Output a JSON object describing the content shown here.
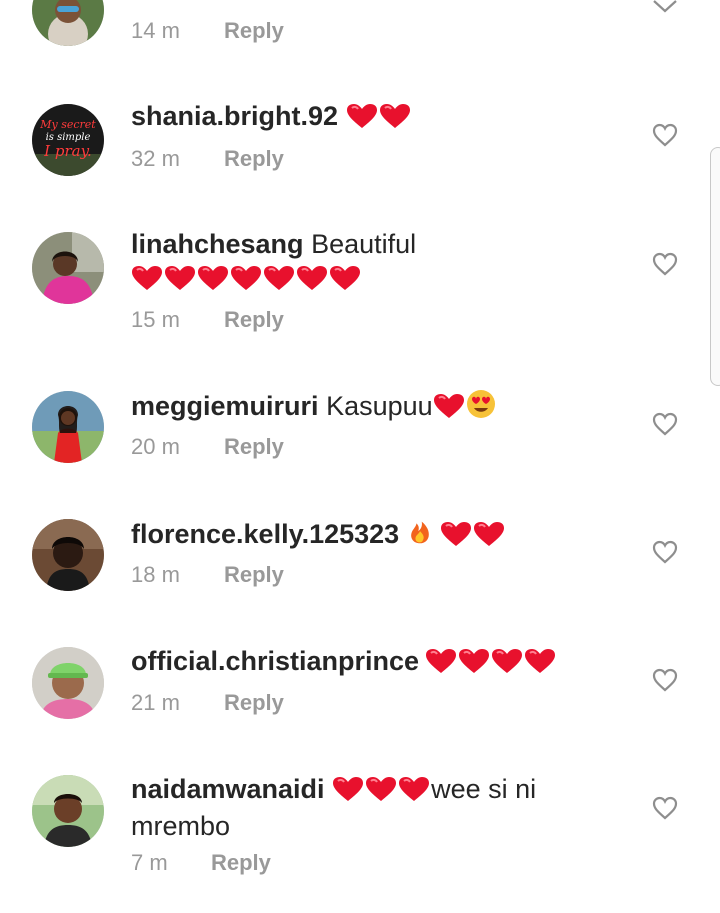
{
  "top_comment": {
    "time": "14 m",
    "reply": "Reply"
  },
  "comments": [
    {
      "username": "shania.bright.92",
      "text": "",
      "hearts": 2,
      "time": "32 m",
      "reply": "Reply",
      "avatar": "avatar-quote-my-secret-is-simple-i-pray",
      "avatar_text": [
        "My secret",
        "is simple",
        "I pray."
      ]
    },
    {
      "username": "linahchesang",
      "text": "Beautiful",
      "hearts": 7,
      "time": "15 m",
      "reply": "Reply",
      "avatar": "avatar-woman-pink"
    },
    {
      "username": "meggiemuiruri",
      "text": "Kasupuu",
      "hearts": 1,
      "time": "20 m",
      "reply": "Reply",
      "avatar": "avatar-woman-red-dress"
    },
    {
      "username": "florence.kelly.125323",
      "text": "",
      "hearts": 2,
      "time": "18 m",
      "reply": "Reply",
      "avatar": "avatar-woman-selfie"
    },
    {
      "username": "official.christianprince",
      "text": "",
      "hearts": 4,
      "time": "21 m",
      "reply": "Reply",
      "avatar": "avatar-man-cap"
    },
    {
      "username": "naidamwanaidi",
      "text": "wee si ni",
      "text2": "mrembo",
      "hearts": 3,
      "time": "7 m",
      "reply": "Reply",
      "avatar": "avatar-woman-green"
    }
  ],
  "icons": {
    "like": "heart-outline-icon",
    "expand": "chevron-down-icon",
    "heart_emoji": "red-heart-emoji",
    "fire_emoji": "fire-emoji",
    "love_face_emoji": "heart-eyes-emoji"
  },
  "colors": {
    "text": "#262626",
    "meta": "#999999",
    "heart": "#e8112d"
  }
}
